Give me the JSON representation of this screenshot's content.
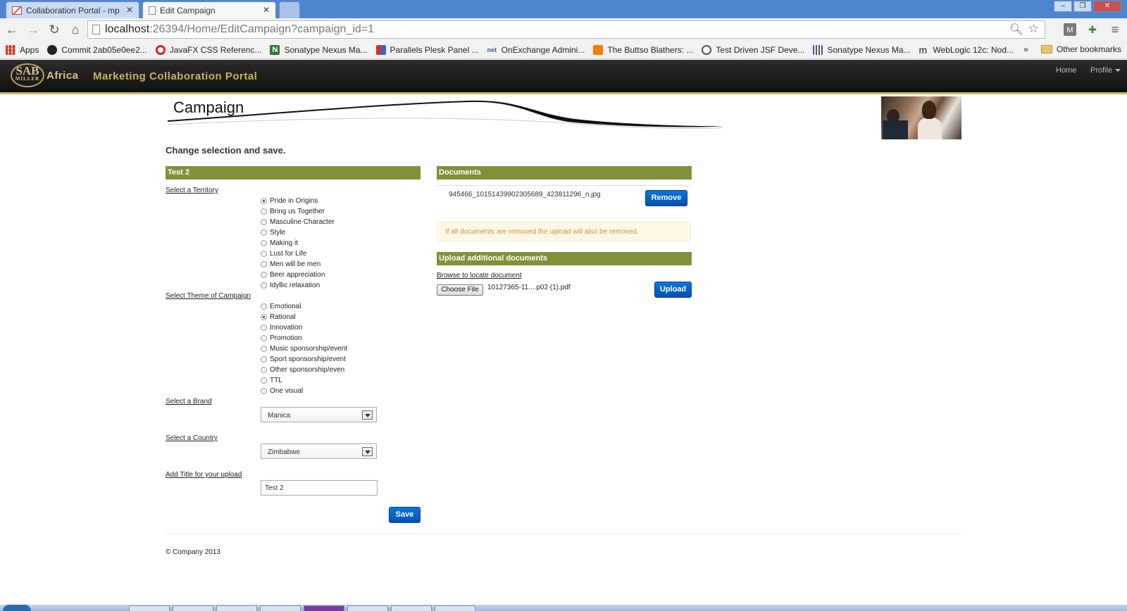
{
  "browser": {
    "tabs": [
      {
        "title": "Collaboration Portal - mp",
        "icon": "gmail-icon",
        "active": false
      },
      {
        "title": "Edit Campaign",
        "icon": "page-icon",
        "active": true
      }
    ],
    "url_host": "localhost",
    "url_rest": ":26394/Home/EditCampaign?campaign_id=1",
    "bookmarks": [
      {
        "label": "Apps",
        "icon": "apps-grid-icon"
      },
      {
        "label": "Commit 2ab05e0ee2...",
        "icon": "github-icon"
      },
      {
        "label": "JavaFX CSS Referenc...",
        "icon": "oracle-icon"
      },
      {
        "label": "Sonatype Nexus Ma...",
        "icon": "nexus-icon"
      },
      {
        "label": "Parallels Plesk Panel ...",
        "icon": "plesk-icon"
      },
      {
        "label": "OnExchange Admini...",
        "icon": "net-icon"
      },
      {
        "label": "The Buttso Blathers: ...",
        "icon": "blogger-icon"
      },
      {
        "label": "Test Driven JSF Deve...",
        "icon": "book-icon"
      },
      {
        "label": "Sonatype Nexus Ma...",
        "icon": "nexus-bars-icon"
      },
      {
        "label": "WebLogic 12c: Nod...",
        "icon": "m-icon"
      }
    ],
    "overflow": "»",
    "other_bookmarks": "Other bookmarks"
  },
  "navbar": {
    "logo_text": "SAB",
    "logo_subtext": "MILLER",
    "brand_suffix": "Africa",
    "portal_title": "Marketing Collaboration Portal",
    "home": "Home",
    "profile": "Profile"
  },
  "page": {
    "heading": "Campaign",
    "intro": "Change selection and save."
  },
  "form": {
    "section_title": "Test 2",
    "territory_label": "Select a Territory",
    "territories": [
      {
        "label": "Pride in Origins",
        "checked": true
      },
      {
        "label": "Bring us Together",
        "checked": false
      },
      {
        "label": "Masculine Character",
        "checked": false
      },
      {
        "label": "Style",
        "checked": false
      },
      {
        "label": "Making it",
        "checked": false
      },
      {
        "label": "Lust for Life",
        "checked": false
      },
      {
        "label": "Men will be men",
        "checked": false
      },
      {
        "label": "Beer appreciation",
        "checked": false
      },
      {
        "label": "Idyllic relaxation",
        "checked": false
      }
    ],
    "theme_label": "Select Theme of Campaign",
    "themes": [
      {
        "label": "Emotional",
        "checked": false
      },
      {
        "label": "Rational",
        "checked": true
      },
      {
        "label": "Innovation",
        "checked": false
      },
      {
        "label": "Promotion",
        "checked": false
      },
      {
        "label": "Music sponsorship/event",
        "checked": false
      },
      {
        "label": "Sport sponsorship/event",
        "checked": false
      },
      {
        "label": "Other sponsorship/even",
        "checked": false
      },
      {
        "label": "TTL",
        "checked": false
      },
      {
        "label": "One visual",
        "checked": false
      }
    ],
    "brand_label": "Select a Brand",
    "brand_value": "Manica",
    "country_label": "Select a Country",
    "country_value": "Zimbabwe",
    "title_label": "Add Title for your upload",
    "title_value": "Test 2",
    "save": "Save"
  },
  "documents": {
    "section_title": "Documents",
    "files": [
      "945466_10151439902305689_423811296_n.jpg"
    ],
    "remove": "Remove",
    "warning": "If all documents are removed the upload will also be removed.",
    "upload_section_title": "Upload additional documents",
    "browse_label": "Browse to locate document",
    "choose_file": "Choose File",
    "chosen_file": "10127365-11....p02 (1).pdf",
    "upload": "Upload"
  },
  "footer": {
    "copyright": "© Company 2013"
  }
}
